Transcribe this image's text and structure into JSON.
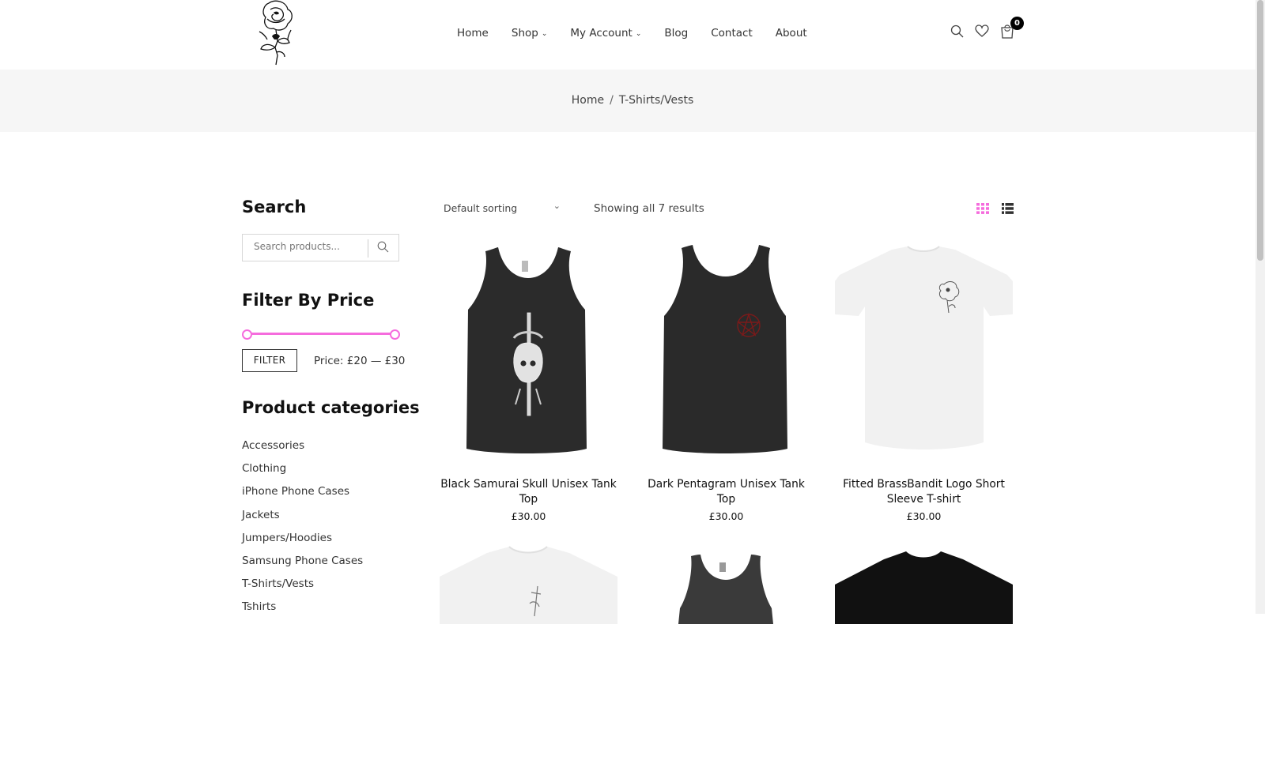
{
  "nav": {
    "items": [
      {
        "label": "Home",
        "dropdown": false
      },
      {
        "label": "Shop",
        "dropdown": true
      },
      {
        "label": "My Account",
        "dropdown": true
      },
      {
        "label": "Blog",
        "dropdown": false
      },
      {
        "label": "Contact",
        "dropdown": false
      },
      {
        "label": "About",
        "dropdown": false
      }
    ],
    "cart_count": "0"
  },
  "breadcrumb": {
    "home": "Home",
    "separator": "/",
    "current": "T-Shirts/Vests"
  },
  "sidebar": {
    "search_title": "Search",
    "search_placeholder": "Search products...",
    "price_title": "Filter By Price",
    "filter_button": "FILTER",
    "price_label": "Price: £20 — £30",
    "price_range": {
      "min": 20,
      "max": 30,
      "currency": "£"
    },
    "categories_title": "Product categories",
    "categories": [
      "Accessories",
      "Clothing",
      "iPhone Phone Cases",
      "Jackets",
      "Jumpers/Hoodies",
      "Samsung Phone Cases",
      "T-Shirts/Vests",
      "Tshirts"
    ]
  },
  "toolbar": {
    "sorting": "Default sorting",
    "results": "Showing all 7 results",
    "active_view": "grid"
  },
  "products": [
    {
      "name": "Black Samurai Skull Unisex Tank Top",
      "price": "£30.00",
      "type": "tank",
      "color": "#2b2b2b",
      "print": "samurai-skull"
    },
    {
      "name": "Dark Pentagram Unisex Tank Top",
      "price": "£30.00",
      "type": "tank",
      "color": "#2a2a2a",
      "print": "pentagram"
    },
    {
      "name": "Fitted BrassBandit Logo Short Sleeve T-shirt",
      "price": "£30.00",
      "type": "tshirt",
      "color": "#f4f4f4",
      "print": "rose-logo"
    },
    {
      "name": "",
      "price": "",
      "type": "tshirt",
      "color": "#f4f4f4",
      "print": "sword"
    },
    {
      "name": "",
      "price": "",
      "type": "tank",
      "color": "#3a3a3a",
      "print": "none"
    },
    {
      "name": "",
      "price": "",
      "type": "tshirt",
      "color": "#111111",
      "print": "none"
    }
  ],
  "colors": {
    "accent": "#f56cdd",
    "breadcrumb_bg": "#f6f6f6",
    "text": "#222222"
  }
}
